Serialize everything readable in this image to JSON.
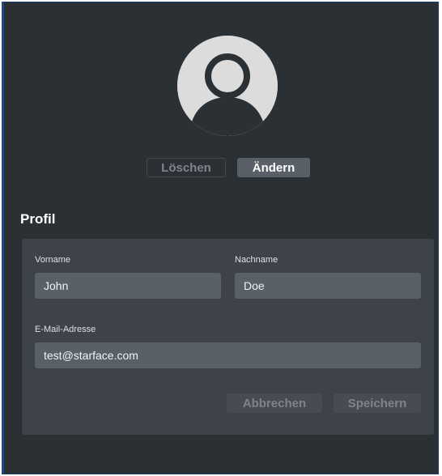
{
  "avatar": {
    "icon": "user-silhouette-icon"
  },
  "actions": {
    "delete_label": "Löschen",
    "change_label": "Ändern"
  },
  "profile": {
    "title": "Profil",
    "first_name": {
      "label": "Vorname",
      "value": "John"
    },
    "last_name": {
      "label": "Nachname",
      "value": "Doe"
    },
    "email": {
      "label": "E-Mail-Adresse",
      "value": "test@starface.com"
    },
    "cancel_label": "Abbrechen",
    "save_label": "Speichern"
  },
  "colors": {
    "background": "#2b3035",
    "card": "#3d4349",
    "input": "#596067",
    "avatar": "#dcdcdc",
    "avatar_figure": "#2b3035"
  }
}
